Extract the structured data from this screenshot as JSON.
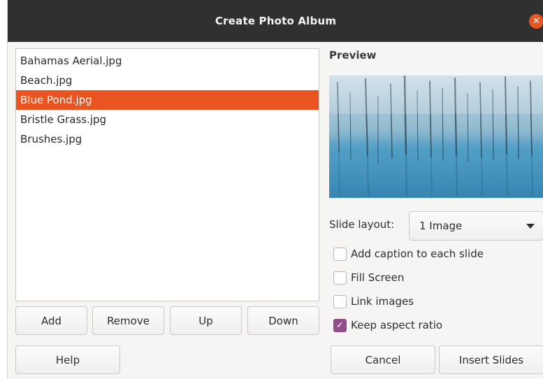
{
  "dialog": {
    "title": "Create Photo Album",
    "close_icon": "close-icon"
  },
  "files": [
    {
      "name": "Bahamas Aerial.jpg",
      "selected": false
    },
    {
      "name": "Beach.jpg",
      "selected": false
    },
    {
      "name": "Blue Pond.jpg",
      "selected": true
    },
    {
      "name": "Bristle Grass.jpg",
      "selected": false
    },
    {
      "name": "Brushes.jpg",
      "selected": false
    }
  ],
  "list_buttons": {
    "add": "Add",
    "remove": "Remove",
    "up": "Up",
    "down": "Down"
  },
  "preview": {
    "label": "Preview"
  },
  "slide_layout": {
    "label": "Slide layout:",
    "value": "1 Image"
  },
  "options": {
    "caption": {
      "label": "Add caption to each slide",
      "checked": false
    },
    "fill_screen": {
      "label": "Fill Screen",
      "checked": false
    },
    "link_images": {
      "label": "Link images",
      "checked": false
    },
    "keep_aspect": {
      "label": "Keep aspect ratio",
      "checked": true
    }
  },
  "footer": {
    "help": "Help",
    "cancel": "Cancel",
    "insert": "Insert Slides"
  },
  "colors": {
    "accent": "#e95420",
    "checkbox_checked": "#924d8b",
    "titlebar": "#303030"
  }
}
